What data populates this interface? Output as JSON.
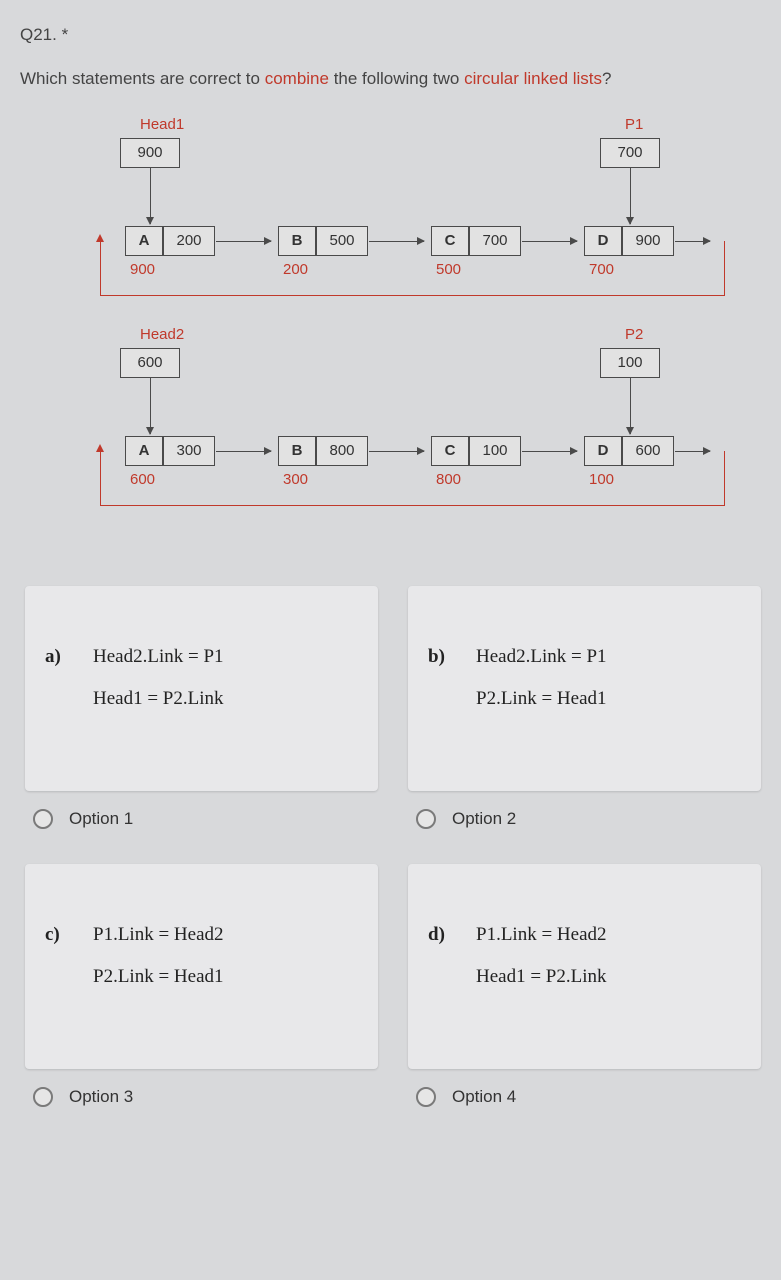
{
  "question_number": "Q21. *",
  "question_prefix": "Which statements are correct to ",
  "question_hl1": "combine",
  "question_mid": " the following two ",
  "question_hl2": "circular linked lists",
  "question_suffix": "?",
  "list1": {
    "head_label": "Head1",
    "head_val": "900",
    "p_label": "P1",
    "p_val": "700",
    "nodes": [
      {
        "name": "A",
        "link": "200",
        "addr": "900"
      },
      {
        "name": "B",
        "link": "500",
        "addr": "200"
      },
      {
        "name": "C",
        "link": "700",
        "addr": "500"
      },
      {
        "name": "D",
        "link": "900",
        "addr": "700"
      }
    ]
  },
  "list2": {
    "head_label": "Head2",
    "head_val": "600",
    "p_label": "P2",
    "p_val": "100",
    "nodes": [
      {
        "name": "A",
        "link": "300",
        "addr": "600"
      },
      {
        "name": "B",
        "link": "800",
        "addr": "300"
      },
      {
        "name": "C",
        "link": "100",
        "addr": "800"
      },
      {
        "name": "D",
        "link": "600",
        "addr": "100"
      }
    ]
  },
  "options": {
    "a": {
      "tag": "a)",
      "line1": "Head2.Link = P1",
      "line2": "Head1 = P2.Link",
      "radio": "Option 1"
    },
    "b": {
      "tag": "b)",
      "line1": "Head2.Link = P1",
      "line2": "P2.Link = Head1",
      "radio": "Option 2"
    },
    "c": {
      "tag": "c)",
      "line1": "P1.Link = Head2",
      "line2": "P2.Link = Head1",
      "radio": "Option 3"
    },
    "d": {
      "tag": "d)",
      "line1": "P1.Link = Head2",
      "line2": "Head1 = P2.Link",
      "radio": "Option 4"
    }
  }
}
